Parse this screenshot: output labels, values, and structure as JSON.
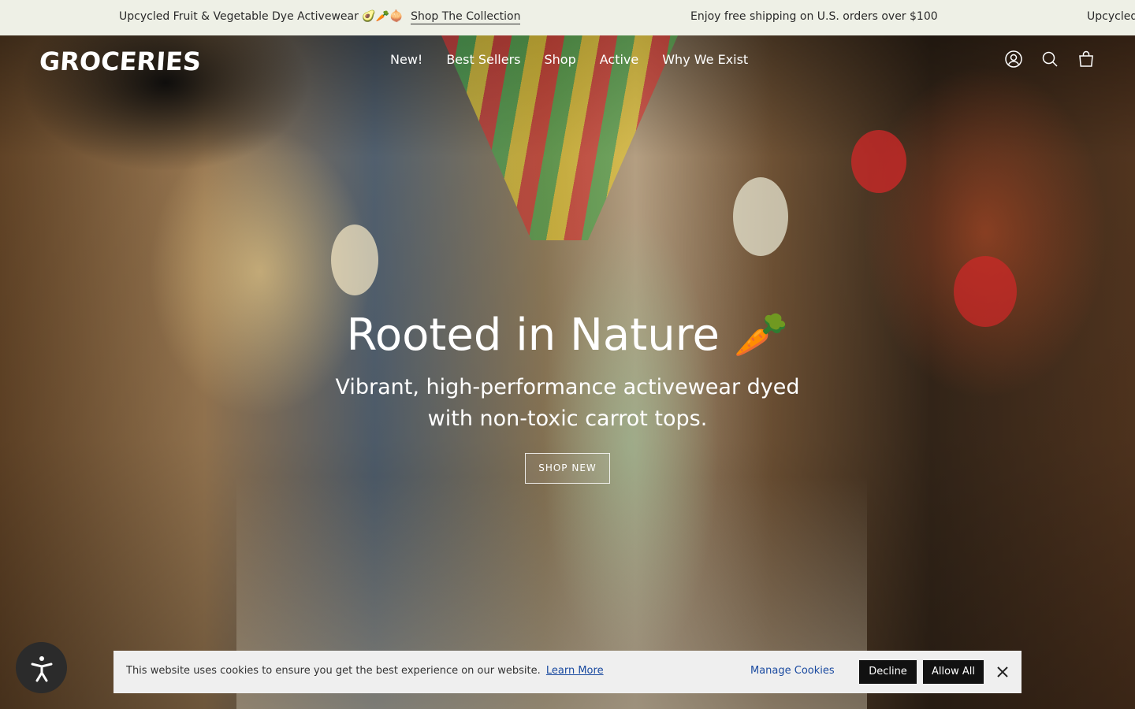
{
  "announcement": {
    "message1": "Upcycled Fruit & Vegetable Dye Activewear 🥑🥕🧅",
    "link1": "Shop The Collection",
    "message2": "Enjoy free shipping on U.S. orders over $100",
    "message3": "Upcycled"
  },
  "header": {
    "logo": "GROCERIES",
    "nav": [
      "New!",
      "Best Sellers",
      "Shop",
      "Active",
      "Why We Exist"
    ],
    "icons": [
      "account-icon",
      "search-icon",
      "cart-icon"
    ]
  },
  "hero": {
    "title": "Rooted in Nature 🥕",
    "subtitle": "Vibrant, high-performance activewear dyed with non-toxic carrot tops.",
    "button": "SHOP NEW"
  },
  "cookie": {
    "text": "This website uses cookies to ensure you get the best experience on our website.",
    "learn_more": "Learn More",
    "manage": "Manage Cookies",
    "decline": "Decline",
    "allow": "Allow All"
  }
}
